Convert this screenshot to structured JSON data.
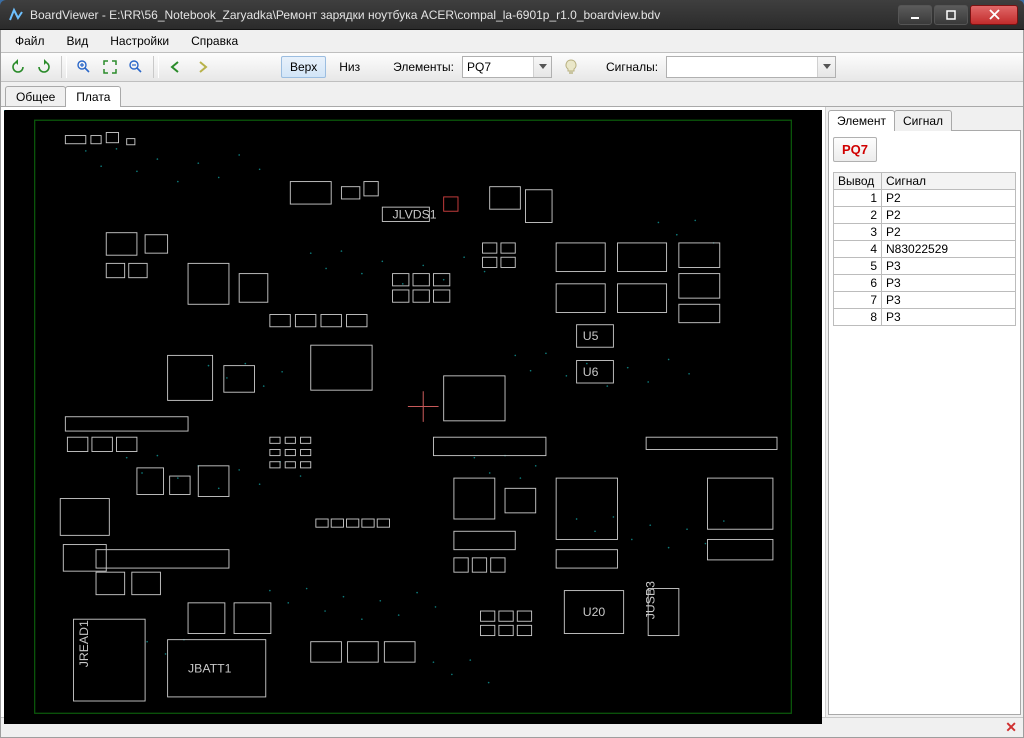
{
  "title": "BoardViewer  -  E:\\RR\\56_Notebook_Zaryadka\\Ремонт зарядки ноутбука ACER\\compal_la-6901p_r1.0_boardview.bdv",
  "menu": {
    "file": "Файл",
    "view": "Вид",
    "settings": "Настройки",
    "help": "Справка"
  },
  "toolbar": {
    "top": "Верх",
    "bottom": "Низ",
    "elements_label": "Элементы:",
    "elements_value": "PQ7",
    "signals_label": "Сигналы:",
    "signals_value": ""
  },
  "tabs": {
    "general": "Общее",
    "board": "Плата"
  },
  "right": {
    "tab_element": "Элемент",
    "tab_signal": "Сигнал",
    "selected": "PQ7",
    "col_pin": "Вывод",
    "col_signal": "Сигнал",
    "pins": [
      {
        "n": "1",
        "sig": "P2"
      },
      {
        "n": "2",
        "sig": "P2"
      },
      {
        "n": "3",
        "sig": "P2"
      },
      {
        "n": "4",
        "sig": "N83022529"
      },
      {
        "n": "5",
        "sig": "P3"
      },
      {
        "n": "6",
        "sig": "P3"
      },
      {
        "n": "7",
        "sig": "P3"
      },
      {
        "n": "8",
        "sig": "P3"
      }
    ]
  },
  "board_labels": {
    "jlvds1": "JLVDS1",
    "u20": "U20",
    "jbatt1": "JBATT1",
    "jread1": "JREAD1",
    "u5": "U5",
    "u6": "U6",
    "jusb3": "JUSB3"
  }
}
